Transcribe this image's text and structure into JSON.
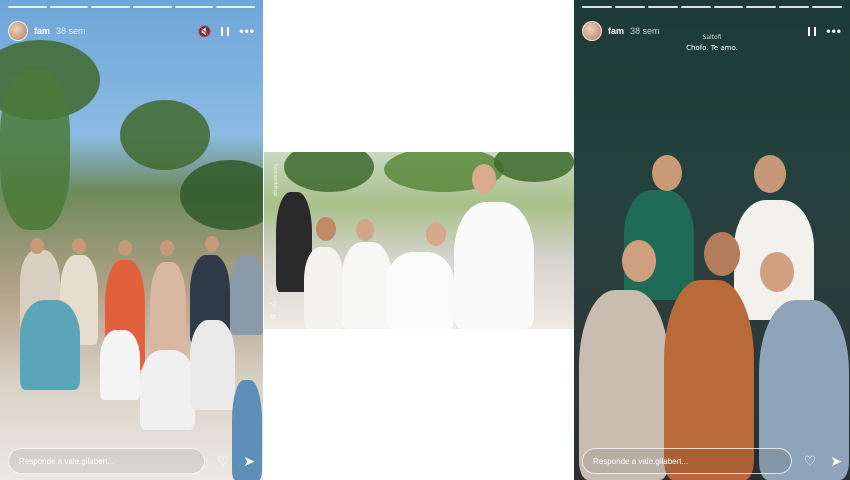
{
  "left_story": {
    "username": "fam",
    "time": "38 sem",
    "mute_icon": "🔇",
    "pause_icon": "pause-icon",
    "more_icon": "•••",
    "reply_placeholder": "Responde a vale.gilabert...",
    "like_icon": "♡",
    "send_icon": "➤",
    "progress_segments": 6
  },
  "middle_photo": {
    "side_text": "fiore.weddings",
    "icons": [
      "♡",
      "◁",
      "⊙"
    ]
  },
  "right_story": {
    "username": "fam",
    "time": "38 sem",
    "caption_author": "Saltofi",
    "caption_text": "Chofo. Te amo.",
    "pause_icon": "pause-icon",
    "more_icon": "•••",
    "reply_placeholder": "Responde a vale.gilabert...",
    "like_icon": "♡",
    "send_icon": "➤",
    "progress_segments": 8
  },
  "colors": {
    "left_sky": "#6fa6d9",
    "right_background": "#1e3a36",
    "chrome": "#ffffff"
  }
}
